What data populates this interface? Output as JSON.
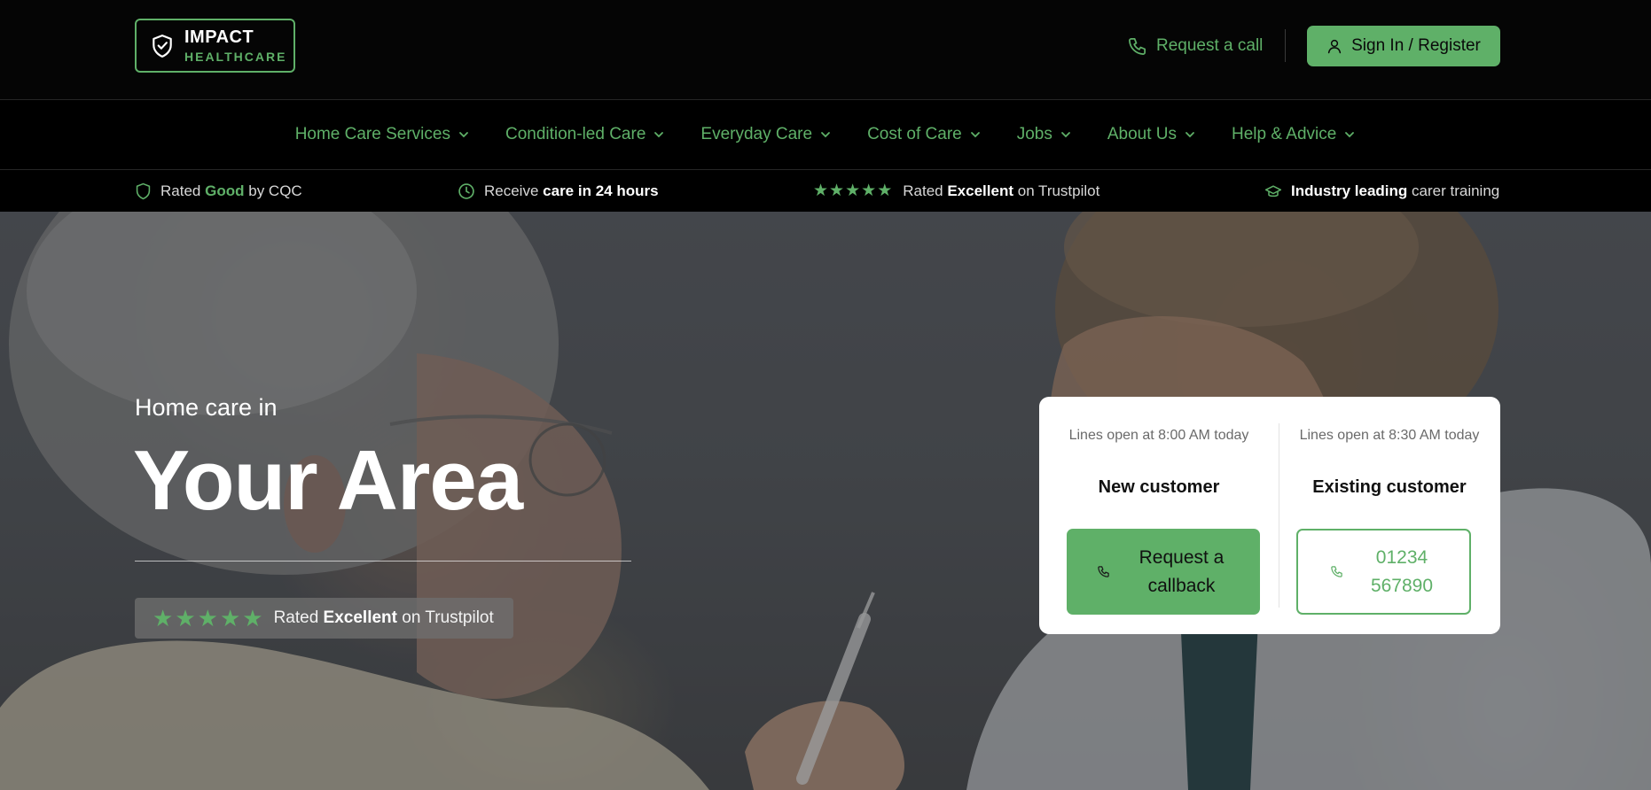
{
  "brand": {
    "name": "IMPACT",
    "tagline": "HEALTHCARE",
    "accent_color": "#5fb068",
    "logo_icon": "shield-check-icon"
  },
  "header": {
    "request_call_label": "Request a call",
    "request_call_icon": "phone-icon",
    "signin_label": "Sign In / Register",
    "signin_icon": "user-icon"
  },
  "nav": {
    "items": [
      {
        "label": "Home Care Services"
      },
      {
        "label": "Condition-led Care"
      },
      {
        "label": "Everyday Care"
      },
      {
        "label": "Cost of Care"
      },
      {
        "label": "Jobs"
      },
      {
        "label": "About Us"
      },
      {
        "label": "Help & Advice"
      }
    ],
    "dropdown_icon": "chevron-down-icon"
  },
  "trust_strip": {
    "cqc": {
      "pre": "Rated",
      "bold": "Good",
      "post": "by CQC",
      "icon": "shield-icon"
    },
    "speed": {
      "pre": "Receive",
      "bold": "care in 24 hours",
      "icon": "clock-icon"
    },
    "trustpilot": {
      "pre": "Rated",
      "bold": "Excellent",
      "post": "on Trustpilot",
      "stars": 5
    },
    "training": {
      "bold": "Industry leading",
      "post": "carer training",
      "icon": "graduation-cap-icon"
    }
  },
  "hero": {
    "subtitle": "Home care in",
    "title": "Your Area",
    "badge": {
      "pre": "Rated",
      "bold": "Excellent",
      "post": "on Trustpilot",
      "stars": 5
    }
  },
  "contact_card": {
    "new_customer": {
      "lines_open": "Lines open at 8:00 AM today",
      "title": "New customer",
      "button_label": "Request a callback"
    },
    "existing_customer": {
      "lines_open": "Lines open at 8:30 AM today",
      "title": "Existing customer",
      "button_label": "01234 567890"
    }
  }
}
